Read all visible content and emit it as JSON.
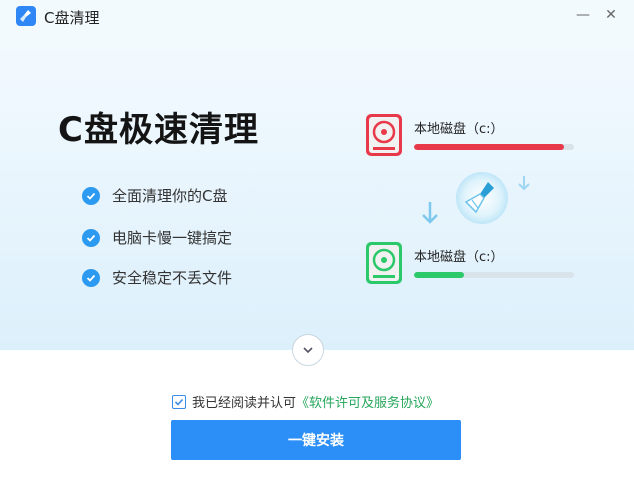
{
  "titlebar": {
    "title": "C盘清理",
    "app_icon": "broom-icon",
    "minimize_glyph": "—",
    "close_glyph": "✕"
  },
  "hero": {
    "title": "C盘极速清理",
    "features": [
      {
        "text": "全面清理你的C盘"
      },
      {
        "text": "电脑卡慢一键搞定"
      },
      {
        "text": "安全稳定不丢文件"
      }
    ]
  },
  "disks": {
    "before": {
      "label": "本地磁盘（c:）",
      "usage": 0.94,
      "color": "#e8394a"
    },
    "after": {
      "label": "本地磁盘（c:）",
      "usage": 0.31,
      "color": "#2cc96b"
    }
  },
  "agreement": {
    "checked": true,
    "prefix": "我已经阅读并认可",
    "link": "《软件许可及服务协议》"
  },
  "install_button": {
    "label": "一键安装"
  },
  "colors": {
    "accent": "#2c8ff7",
    "check": "#2c9af0",
    "link": "#26a65b",
    "red": "#e8394a",
    "green": "#2cc96b"
  }
}
